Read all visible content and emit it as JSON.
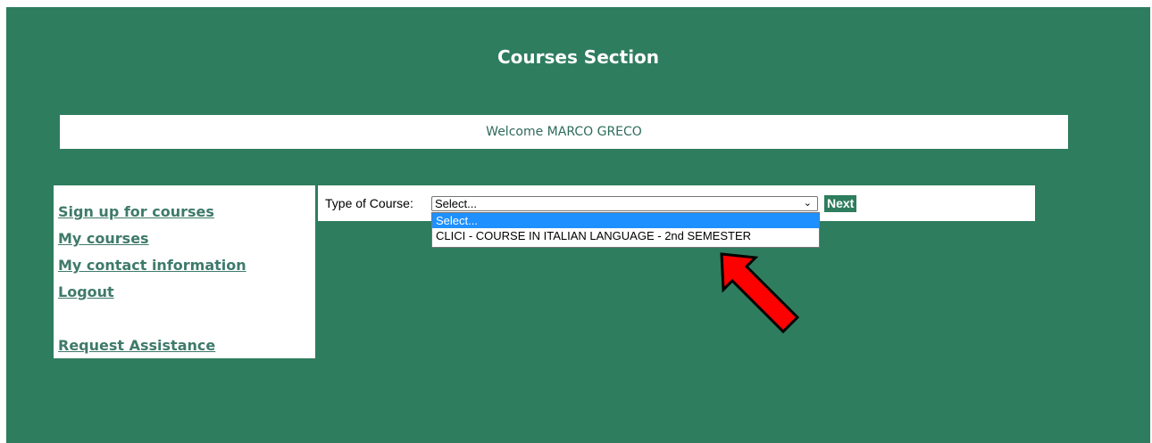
{
  "header": {
    "title": "Courses Section"
  },
  "welcome": {
    "text": "Welcome MARCO GRECO"
  },
  "sidebar": {
    "items": [
      {
        "label": "Sign up for courses"
      },
      {
        "label": "My courses"
      },
      {
        "label": "My contact information"
      },
      {
        "label": "Logout"
      },
      {
        "label": "Request Assistance"
      }
    ]
  },
  "course_form": {
    "label": "Type of Course:",
    "selected_value": "Select...",
    "options": [
      "Select...",
      "CLICI - COURSE IN ITALIAN LANGUAGE - 2nd SEMESTER"
    ],
    "next_label": "Next"
  },
  "colors": {
    "background": "#2e7d5e",
    "link": "#3f7a6a",
    "highlight": "#1e90ff",
    "arrow": "#ff0000"
  },
  "annotation": {
    "icon": "red-arrow-icon"
  }
}
